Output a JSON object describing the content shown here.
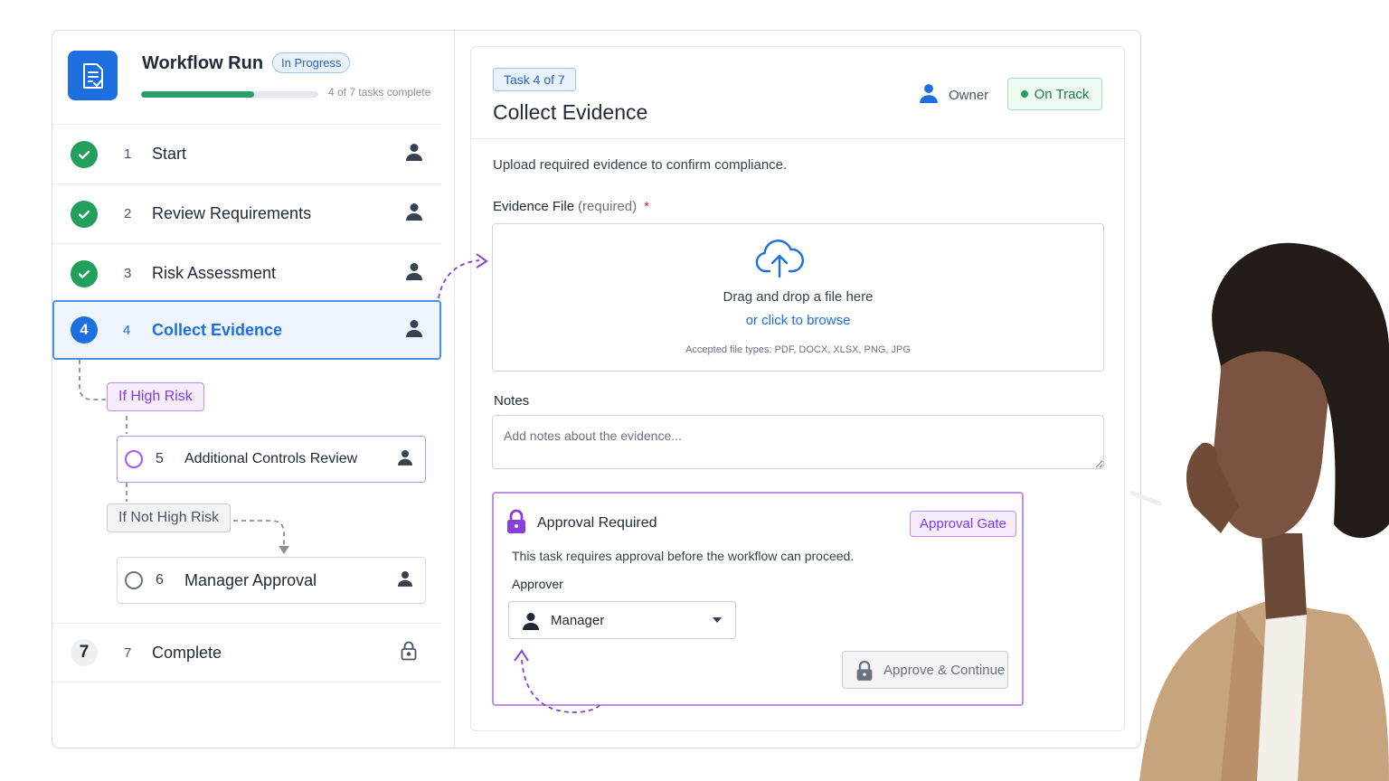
{
  "workflow": {
    "title": "Workflow Run",
    "status_badge": "In Progress",
    "progress_fraction": 0.64,
    "progress_text": "4 of 7 tasks complete"
  },
  "steps": [
    {
      "number": "1",
      "label": "Start",
      "state": "done"
    },
    {
      "number": "2",
      "label": "Review Requirements",
      "state": "done"
    },
    {
      "number": "3",
      "label": "Risk Assessment",
      "state": "done"
    },
    {
      "number": "4",
      "label": "Collect Evidence",
      "state": "current",
      "badge": "4"
    },
    {
      "number": "5",
      "label": "Additional Controls Review",
      "state": "pending"
    },
    {
      "number": "6",
      "label": "Manager Approval",
      "state": "pending"
    },
    {
      "number": "7",
      "label": "Complete",
      "state": "locked",
      "badge": "7"
    }
  ],
  "branches": {
    "high": "If High Risk",
    "not_high": "If Not High Risk"
  },
  "task": {
    "badge": "Task 4 of 7",
    "title": "Collect Evidence",
    "owner_label": "Owner",
    "status": "On Track",
    "description": "Upload required evidence to confirm compliance.",
    "evidence_label": "Evidence File",
    "evidence_required": "(required)",
    "required_star": "*",
    "dropzone_main": "Drag and drop a file here",
    "dropzone_link": "or click to browse",
    "dropzone_types": "Accepted file types: PDF, DOCX, XLSX, PNG, JPG",
    "notes_label": "Notes",
    "notes_placeholder": "Add notes about the evidence..."
  },
  "approval": {
    "title": "Approval Required",
    "gate_badge": "Approval Gate",
    "description": "This task requires approval before the workflow can proceed.",
    "approver_label": "Approver",
    "approver_value": "Manager",
    "button_label": "Approve & Continue"
  },
  "colors": {
    "accent_blue": "#1d6fe0",
    "success_green": "#22a05b",
    "approval_purple": "#a855f7"
  }
}
